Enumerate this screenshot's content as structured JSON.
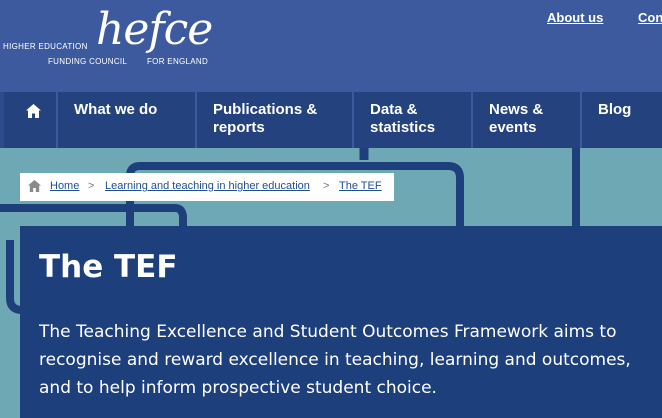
{
  "header": {
    "logo": {
      "wordmark": "hefce",
      "line1": "HIGHER EDUCATION",
      "line2": "FUNDING COUNCIL",
      "line3": "FOR ENGLAND"
    },
    "links": {
      "about": "About us",
      "contact": "Con"
    }
  },
  "nav": {
    "items": [
      {
        "label": "What we do"
      },
      {
        "label": "Publications & reports"
      },
      {
        "label": "Data & statistics"
      },
      {
        "label": "News & events"
      },
      {
        "label": "Blog"
      }
    ]
  },
  "breadcrumb": {
    "items": [
      {
        "label": "Home"
      },
      {
        "label": "Learning and teaching in higher education"
      },
      {
        "label": "The TEF"
      }
    ],
    "separator": ">"
  },
  "main": {
    "title": "The TEF",
    "intro": "The Teaching Excellence and Student Outcomes Framework aims to recognise and reward excellence in teaching, learning and outcomes, and to help inform prospective student choice."
  },
  "colors": {
    "header_bg": "#3d5a9e",
    "nav_item_bg": "#24427e",
    "background": "#6fa8b5",
    "panel_bg": "#1d3f7c",
    "link": "#1d4f91"
  }
}
